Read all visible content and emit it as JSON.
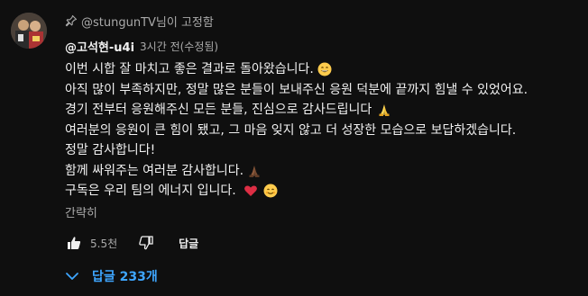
{
  "pinned": {
    "text": "@stungunTV님이 고정함"
  },
  "comment": {
    "author": "@고석현-u4i",
    "timestamp": "3시간 전(수정됨)",
    "lines": [
      "이번 시합 잘 마치고 좋은 결과로 돌아왔습니다.",
      "아직 많이 부족하지만, 정말 많은 분들이 보내주신 응원 덕분에 끝까지 힘낼 수 있었어요.",
      "경기 전부터 응원해주신 모든 분들, 진심으로 감사드립니다",
      "여러분의 응원이 큰 힘이 됐고, 그 마음 잊지 않고 더 성장한 모습으로 보답하겠습니다.",
      "정말 감사합니다!",
      "함께 싸워주는 여러분 감사합니다.",
      "구독은 우리 팀의 에너지 입니다."
    ],
    "collapse_label": "간략히",
    "like_count": "5.5천",
    "reply_label": "답글",
    "replies_label": "답글 233개"
  },
  "icons": {
    "pin": "pin-icon",
    "like": "thumbs-up-icon",
    "dislike": "thumbs-down-icon",
    "chevron": "chevron-down-icon",
    "grin": "grinning-face-emoji",
    "pray": "folded-hands-emoji",
    "heart": "red-heart-emoji",
    "smile": "smiling-face-emoji"
  },
  "colors": {
    "background": "#0f0f0f",
    "text": "#f1f1f1",
    "secondary": "#aaaaaa",
    "link": "#3ea6ff"
  }
}
